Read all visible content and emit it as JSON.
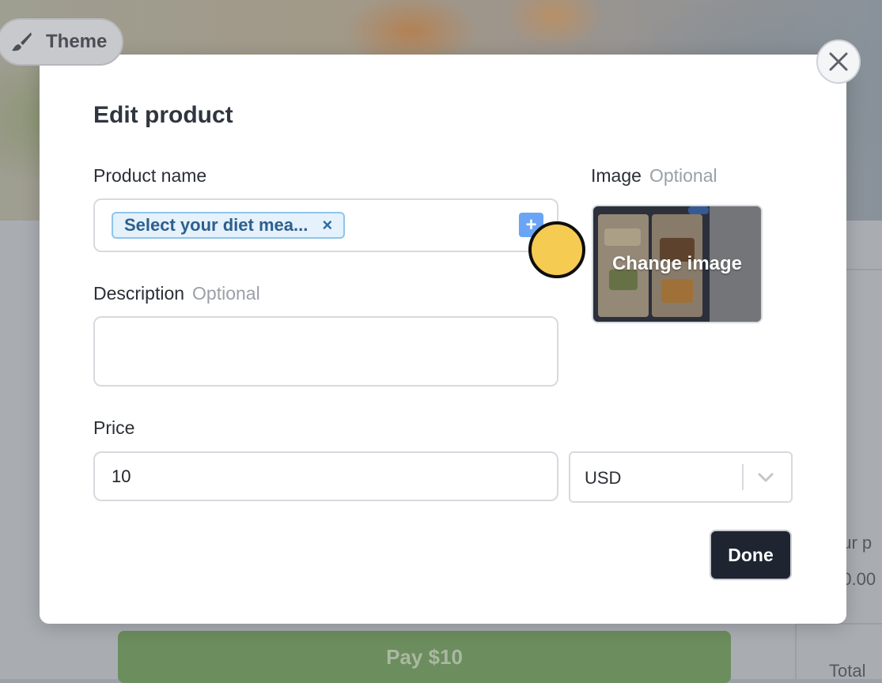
{
  "background": {
    "theme_label": "Theme",
    "pay_label": "Pay $10",
    "side_text_1": "our p",
    "side_text_2": "10.00",
    "side_text_3": "Total"
  },
  "modal": {
    "title": "Edit product",
    "product_name": {
      "label": "Product name",
      "chip_text": "Select your diet mea...",
      "chip_remove": "×",
      "add_button": "+"
    },
    "image": {
      "label": "Image",
      "optional": "Optional",
      "change_label": "Change image"
    },
    "description": {
      "label": "Description",
      "optional": "Optional",
      "value": ""
    },
    "price": {
      "label": "Price",
      "value": "10",
      "currency": "USD"
    },
    "done_label": "Done"
  },
  "colors": {
    "primary_button": "#1e2430",
    "chip_bg": "#e5f1fb",
    "chip_border": "#8ec5ec",
    "add_button": "#6aa5f5",
    "pay_button": "#6c8d5e",
    "cursor": "#f6cb52"
  },
  "icons": [
    "brush-icon",
    "close-icon",
    "plus-icon",
    "chevron-down-icon"
  ]
}
